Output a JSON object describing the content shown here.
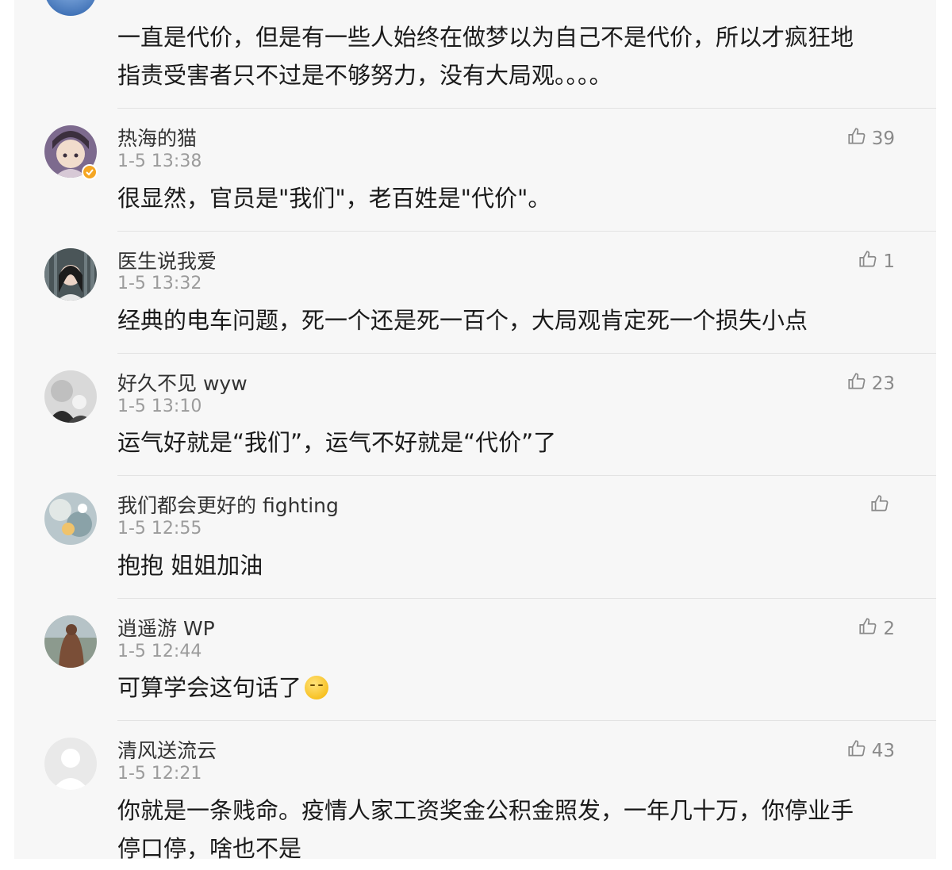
{
  "comments": [
    {
      "username": "",
      "time": "",
      "text_lines": [
        "一直是代价，但是有一些人始终在做梦以为自己不是代价，所以才疯狂地",
        "指责受害者只不过是不够努力，没有大局观。。。。"
      ],
      "likes": ""
    },
    {
      "username": "热海的猫",
      "time": "1-5 13:38",
      "text_lines": [
        "很显然，官员是\"我们\"，老百姓是\"代价\"。"
      ],
      "likes": "39",
      "verified": true
    },
    {
      "username": "医生说我爱",
      "time": "1-5 13:32",
      "text_lines": [
        "经典的电车问题，死一个还是死一百个，大局观肯定死一个损失小点"
      ],
      "likes": "1"
    },
    {
      "username": "好久不见 wyw",
      "time": "1-5 13:10",
      "text_lines": [
        "运气好就是“我们”，运气不好就是“代价”了"
      ],
      "likes": "23"
    },
    {
      "username": "我们都会更好的 fighting",
      "time": "1-5 12:55",
      "text_lines": [
        "抱抱 姐姐加油"
      ],
      "likes": ""
    },
    {
      "username": "逍遥游 WP",
      "time": "1-5 12:44",
      "text_lines": [
        "可算学会这句话了"
      ],
      "likes": "2",
      "emoji": "shush-face-emoji"
    },
    {
      "username": "清风送流云",
      "time": "1-5 12:21",
      "text_lines": [
        "你就是一条贱命。疫情人家工资奖金公积金照发，一年几十万，你停业手",
        "停口停，啥也不是"
      ],
      "likes": "43"
    }
  ],
  "icons": {
    "like": "thumbs-up-icon",
    "verified": "verified-badge-icon",
    "default_avatar": "default-avatar-icon"
  },
  "colors": {
    "panel_bg": "#f7f7f7",
    "username": "#333333",
    "time": "#9b9b9b",
    "text": "#1a1a1a",
    "like": "#8a8a8a",
    "verified": "#f5a623",
    "divider": "#e3e3e3"
  }
}
